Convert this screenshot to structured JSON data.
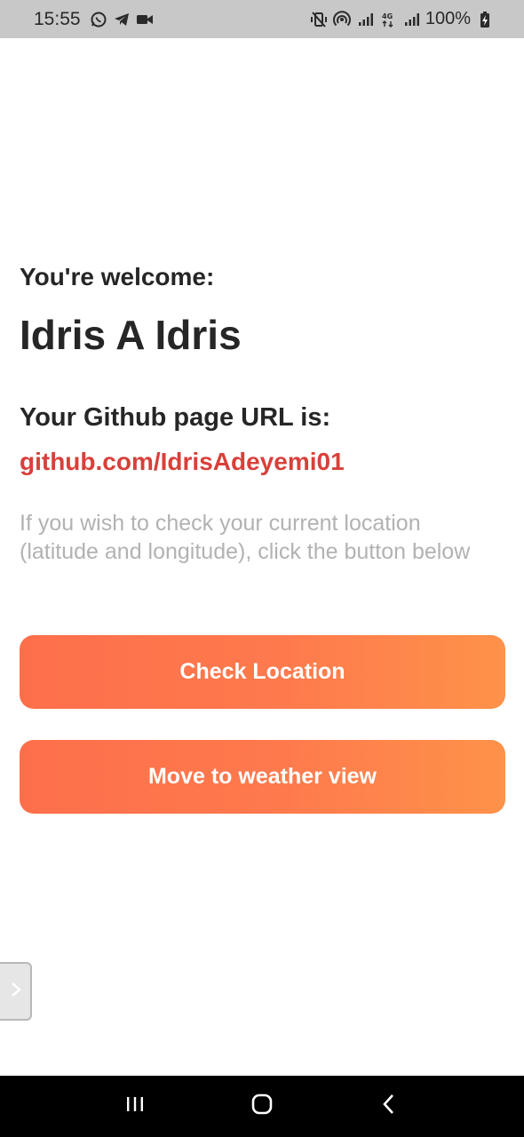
{
  "status_bar": {
    "time": "15:55",
    "left_icons": [
      "whatsapp-icon",
      "telegram-icon",
      "video-icon"
    ],
    "right_icons": [
      "vibrate-mute-icon",
      "hotspot-icon",
      "signal-icon",
      "4g-icon",
      "signal-icon",
      "battery-charging-icon"
    ],
    "battery": "100%"
  },
  "main": {
    "welcome_label": "You're welcome:",
    "user_name": "Idris A Idris",
    "github_label": "Your Github page URL is:",
    "github_url": "github.com/IdrisAdeyemi01",
    "hint": "If you wish to check your current location (latitude and longitude), click the button below",
    "check_location_label": "Check Location",
    "weather_view_label": "Move to weather view"
  },
  "colors": {
    "accent_start": "#fd6f4b",
    "accent_end": "#fe9249",
    "link": "#d8403a",
    "heading": "#262626",
    "hint": "#b2b2b2"
  },
  "nav_bar": {
    "buttons": [
      "recents-icon",
      "home-icon",
      "back-icon"
    ]
  }
}
